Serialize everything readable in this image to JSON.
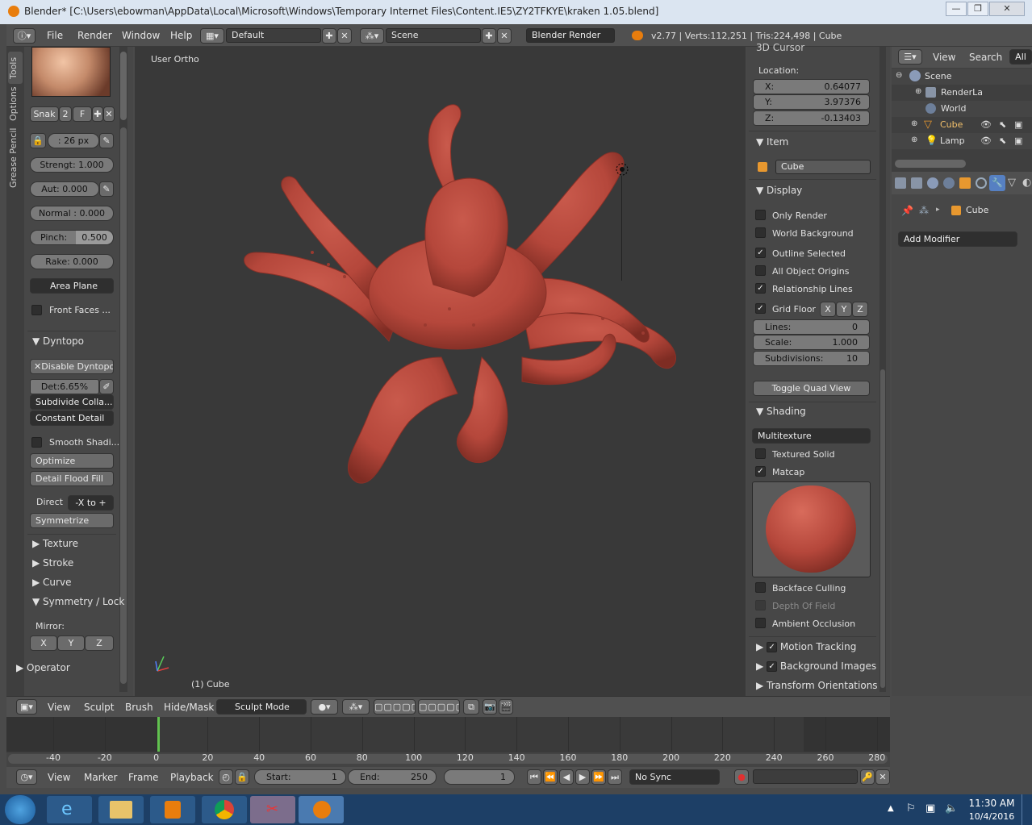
{
  "window": {
    "title": "Blender* [C:\\Users\\ebowman\\AppData\\Local\\Microsoft\\Windows\\Temporary Internet Files\\Content.IE5\\ZY2TFKYE\\kraken 1.05.blend]",
    "min": "—",
    "max": "❐",
    "close": "✕"
  },
  "info": {
    "menu": [
      "File",
      "Render",
      "Window",
      "Help"
    ],
    "layout": "Default",
    "scene": "Scene",
    "engine": "Blender Render",
    "stats": "v2.77 | Verts:112,251 | Tris:224,498 | Cube"
  },
  "tools": {
    "tabs": [
      "Tools",
      "Options",
      "Grease Pencil"
    ],
    "brush_name": "Snak",
    "brush_users": "2",
    "brush_fake": "F",
    "radius": ": 26 px",
    "strength": "Strengt: 1.000",
    "autosmooth": "Aut: 0.000",
    "normal": "Normal : 0.000",
    "pinch_label": "Pinch:",
    "pinch_value": "0.500",
    "rake": "Rake:   0.000",
    "area_plane": "Area Plane",
    "front_faces": "Front Faces ...",
    "dyntopo_header": "Dyntopo",
    "disable_dyntopo": "Disable Dyntopo",
    "detail": "Det:6.65%",
    "subdivide": "Subdivide Colla...",
    "constant_detail": "Constant Detail",
    "smooth_shading": "Smooth Shadi...",
    "optimize": "Optimize",
    "detail_flood": "Detail Flood Fill",
    "direction_label": "Direct",
    "direction_value": "-X to +",
    "symmetrize": "Symmetrize",
    "texture": "Texture",
    "stroke": "Stroke",
    "curve": "Curve",
    "symmetry": "Symmetry / Lock",
    "mirror": "Mirror:",
    "axes": [
      "X",
      "Y",
      "Z"
    ],
    "operator": "Operator"
  },
  "viewport": {
    "view_name": "User Ortho",
    "object_label": "(1) Cube"
  },
  "nprops": {
    "cursor_header": "3D Cursor",
    "location": "Location:",
    "x_label": "X:",
    "x": "0.64077",
    "y_label": "Y:",
    "y": "3.97376",
    "z_label": "Z:",
    "z": "-0.13403",
    "item_header": "Item",
    "item_name": "Cube",
    "display_header": "Display",
    "only_render": "Only Render",
    "world_bg": "World Background",
    "outline_selected": "Outline Selected",
    "all_origins": "All Object Origins",
    "relationship_lines": "Relationship Lines",
    "grid_floor": "Grid Floor",
    "lines_label": "Lines:",
    "lines": "0",
    "scale_label": "Scale:",
    "scale": "1.000",
    "subdiv_label": "Subdivisions:",
    "subdiv": "10",
    "toggle_quad": "Toggle Quad View",
    "shading_header": "Shading",
    "shading_mode": "Multitexture",
    "textured_solid": "Textured Solid",
    "matcap": "Matcap",
    "backface": "Backface Culling",
    "dof": "Depth Of Field",
    "ao": "Ambient Occlusion",
    "motion_tracking": "Motion Tracking",
    "background_images": "Background Images",
    "transform_orientations": "Transform Orientations"
  },
  "outliner": {
    "view": "View",
    "search": "Search",
    "all": "All",
    "items": [
      "Scene",
      "RenderLa",
      "World",
      "Cube",
      "Lamp"
    ]
  },
  "propeditor": {
    "object": "Cube",
    "add_modifier": "Add Modifier"
  },
  "vpheader": {
    "menu": [
      "View",
      "Sculpt",
      "Brush",
      "Hide/Mask"
    ],
    "mode": "Sculpt Mode"
  },
  "timeline": {
    "ticks": [
      "-40",
      "-20",
      "0",
      "20",
      "40",
      "60",
      "80",
      "100",
      "120",
      "140",
      "160",
      "180",
      "200",
      "220",
      "240",
      "260",
      "280"
    ]
  },
  "tlheader": {
    "menu": [
      "View",
      "Marker",
      "Frame",
      "Playback"
    ],
    "start_label": "Start:",
    "start": "1",
    "end_label": "End:",
    "end": "250",
    "current": "1",
    "sync": "No Sync"
  },
  "taskbar": {
    "time": "11:30 AM",
    "date": "10/4/2016"
  },
  "colors": {
    "accent": "#5680c2",
    "octopus": "#b5473b",
    "active_frame": "#61c24f"
  }
}
